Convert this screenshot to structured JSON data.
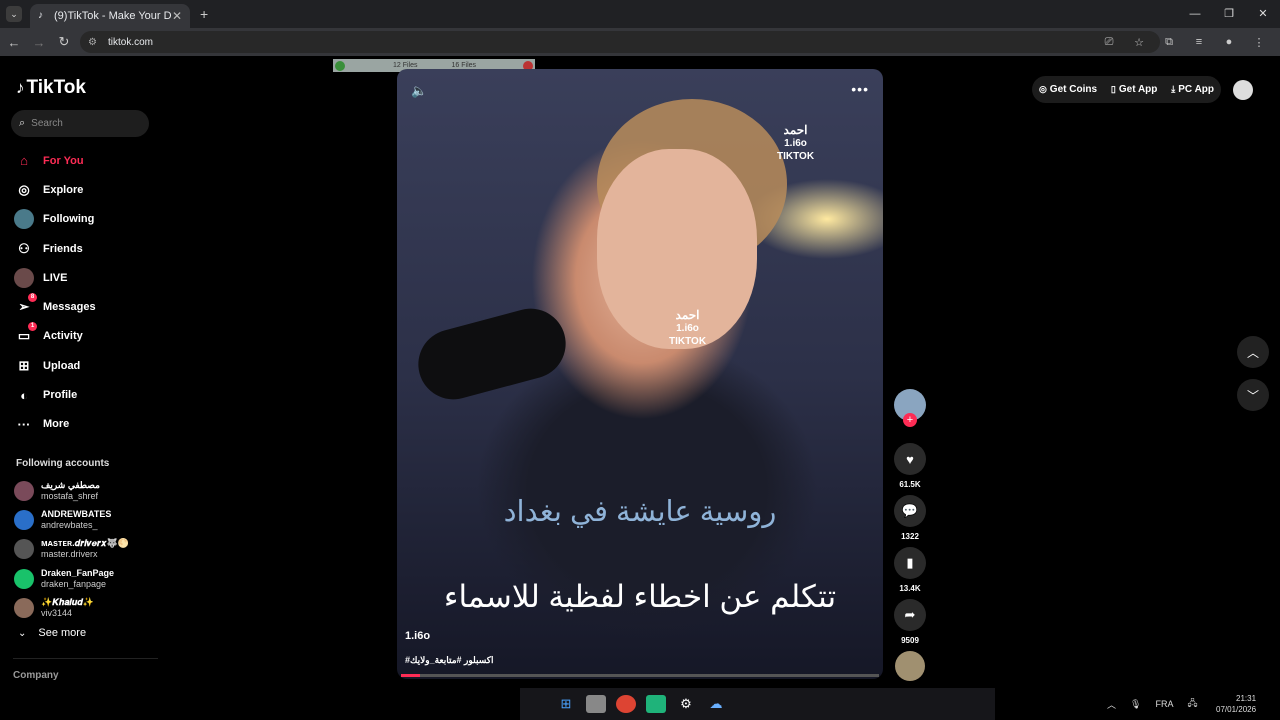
{
  "browser": {
    "tab_title": "(9)TikTok - Make Your Day",
    "url": "tiktok.com"
  },
  "downloads": {
    "files": "12 Files",
    "count": "16 Files"
  },
  "sidebar": {
    "logo": "TikTok",
    "search_placeholder": "Search",
    "items": [
      {
        "label": "For You"
      },
      {
        "label": "Explore"
      },
      {
        "label": "Following"
      },
      {
        "label": "Friends"
      },
      {
        "label": "LIVE"
      },
      {
        "label": "Messages",
        "badge": "8"
      },
      {
        "label": "Activity",
        "badge": "1"
      },
      {
        "label": "Upload"
      },
      {
        "label": "Profile"
      },
      {
        "label": "More"
      }
    ],
    "following_title": "Following accounts",
    "following": [
      {
        "name": "مصطفي شريف",
        "handle": "mostafa_shref",
        "color": "#7a4a5a"
      },
      {
        "name": "ANDREWBATES",
        "handle": "andrewbates_",
        "color": "#2a6fc9"
      },
      {
        "name": "ᴍᴀsᴛᴇʀ.𝒅𝒓𝒊𝒗𝒆𝒓𝒙🐺🌕",
        "handle": "master.driverx",
        "color": "#555555"
      },
      {
        "name": "Draken_FanPage",
        "handle": "draken_fanpage",
        "color": "#19c26a"
      },
      {
        "name": "✨𝑲𝒉𝒂𝒍𝒖𝒅✨",
        "handle": "viv3144",
        "color": "#8a6a5a"
      }
    ],
    "see_more": "See more",
    "company": "Company"
  },
  "video": {
    "watermark_name": "احمد",
    "watermark_id": "1.i6o",
    "watermark_brand": "TIKTOK",
    "caption_top": "روسية عايشة في بغداد",
    "caption_bottom": "تتكلم عن اخطاء لفظية للاسماء",
    "username": "1.i6o",
    "hashtags": "#اكسبلور #متابعة_ولايك",
    "progress": 0.04
  },
  "actions": {
    "likes": "61.5K",
    "comments": "1322",
    "saves": "13.4K",
    "shares": "9509"
  },
  "topbar": {
    "get_coins": "Get Coins",
    "get_app": "Get App",
    "pc_app": "PC App"
  },
  "taskbar": {
    "lang": "FRA",
    "time": "21:31",
    "date": "07/01/2026"
  }
}
